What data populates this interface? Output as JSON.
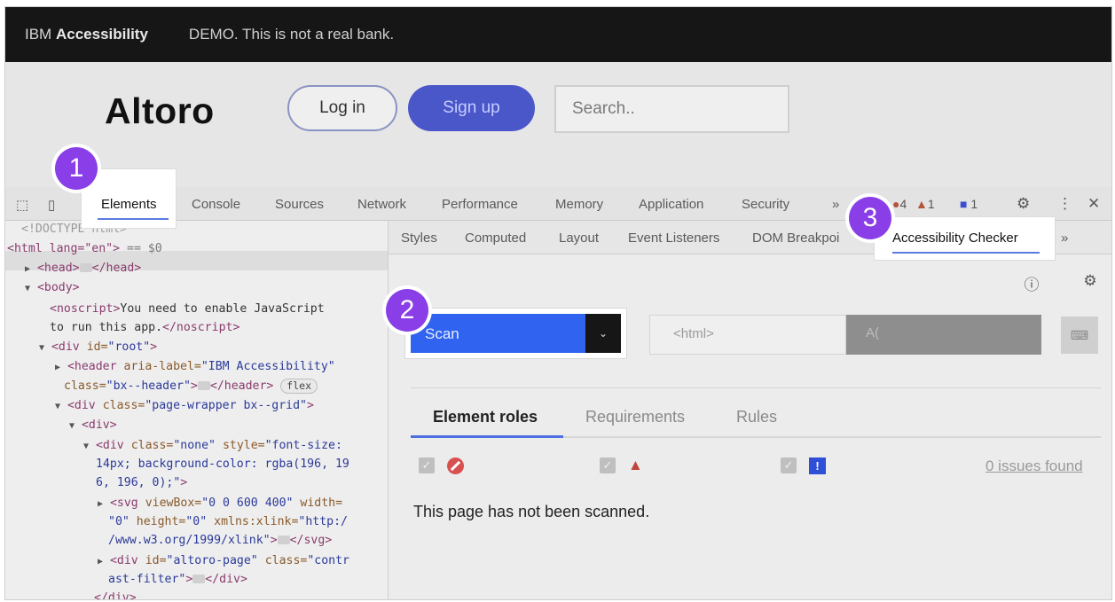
{
  "banner": {
    "brand_prefix": "IBM",
    "brand_name": "Accessibility",
    "demo_text": "DEMO. This is not a real bank."
  },
  "site": {
    "logo": "Altoro",
    "login_label": "Log in",
    "signup_label": "Sign up",
    "search_placeholder": "Search.."
  },
  "devtools": {
    "tabs": [
      "Elements",
      "Console",
      "Sources",
      "Network",
      "Performance",
      "Memory",
      "Application",
      "Security"
    ],
    "more": "»",
    "errors_count": "4",
    "warnings_count": "1",
    "messages_count": "1",
    "close": "✕"
  },
  "dom": {
    "doctype": "<!DOCTYPE html>",
    "html_open": "<html lang=\"en\">",
    "html_sel": "== $0",
    "head_open": "<head>",
    "head_close": "</head>",
    "body_open": "<body>",
    "noscript_open": "<noscript>",
    "noscript_text_1": "You need to enable JavaScript",
    "noscript_text_2": "to run this app.",
    "noscript_close": "</noscript>",
    "div_root_tag": "<div",
    "div_root_attr": "id=",
    "div_root_val": "\"root\"",
    "header_tag": "<header",
    "header_attr": "aria-label=",
    "header_val": "\"IBM Accessibility\"",
    "header_cls_attr": "class=",
    "header_cls_val": "\"bx--header\"",
    "header_close": "</header>",
    "header_chip": "flex",
    "wrap_tag": "<div",
    "wrap_attr": "class=",
    "wrap_val": "\"page-wrapper bx--grid\"",
    "inner_div": "<div>",
    "none_tag": "<div",
    "none_attr1": "class=",
    "none_val1": "\"none\"",
    "none_attr2": "style=",
    "none_val2a": "\"font-size:",
    "none_val2b": "14px; background-color: rgba(196, 19",
    "none_val2c": "6, 196, 0);\"",
    "svg_tag": "<svg",
    "svg_attr1": "viewBox=",
    "svg_val1": "\"0 0 600 400\"",
    "svg_attr2": "width=",
    "svg_val2": "\"0\"",
    "svg_attr3": "height=",
    "svg_val3": "\"0\"",
    "svg_attr4": "xmlns:xlink=",
    "svg_val4a": "\"http:/",
    "svg_val4b": "/www.w3.org/1999/xlink\"",
    "svg_close": "</svg>",
    "altoro_tag": "<div",
    "altoro_attr1": "id=",
    "altoro_val1": "\"altoro-page\"",
    "altoro_attr2": "class=",
    "altoro_val2a": "\"contr",
    "altoro_val2b": "ast-filter\"",
    "altoro_close": "</div>",
    "div_close": "</div>"
  },
  "side_tabs": [
    "Styles",
    "Computed",
    "Layout",
    "Event Listeners",
    "DOM Breakpoints"
  ],
  "side_tabs_visible": [
    "Styles",
    "Computed",
    "Layout",
    "Event Listeners",
    "DOM Breakpoi"
  ],
  "checker": {
    "tab_label": "Accessibility Checker",
    "more": "»",
    "scan_label": "Scan",
    "html_selector": "<html>",
    "ruleset": "A(",
    "result_tabs": [
      "Element roles",
      "Requirements",
      "Rules"
    ],
    "issues_found": "0 issues found",
    "not_scanned": "This page has not been scanned."
  },
  "callouts": [
    "1",
    "2",
    "3"
  ],
  "colors": {
    "accent": "#8a3ee8",
    "scan_blue": "#2f63f0",
    "signup_blue": "#4a57c8",
    "banner_bg": "#161616"
  }
}
